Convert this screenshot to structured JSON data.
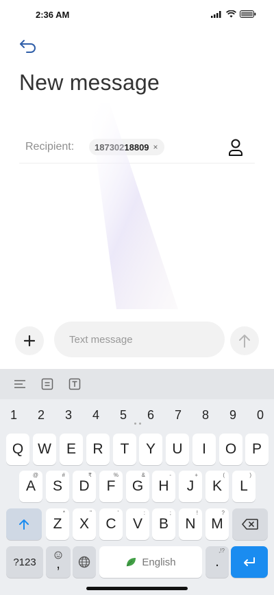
{
  "status": {
    "time": "2:36 AM"
  },
  "page": {
    "title": "New message"
  },
  "recipient": {
    "label": "Recipient:",
    "chip_number": "18730218809",
    "chip_remove": "×"
  },
  "compose": {
    "placeholder": "Text message"
  },
  "keyboard": {
    "numbers": [
      "1",
      "2",
      "3",
      "4",
      "5",
      "6",
      "7",
      "8",
      "9",
      "0"
    ],
    "row1": [
      {
        "key": "Q",
        "hint": ""
      },
      {
        "key": "W",
        "hint": ""
      },
      {
        "key": "E",
        "hint": ""
      },
      {
        "key": "R",
        "hint": ""
      },
      {
        "key": "T",
        "hint": ""
      },
      {
        "key": "Y",
        "hint": ""
      },
      {
        "key": "U",
        "hint": ""
      },
      {
        "key": "I",
        "hint": ""
      },
      {
        "key": "O",
        "hint": ""
      },
      {
        "key": "P",
        "hint": ""
      }
    ],
    "row2": [
      {
        "key": "A",
        "hint": "@"
      },
      {
        "key": "S",
        "hint": "#"
      },
      {
        "key": "D",
        "hint": "₹"
      },
      {
        "key": "F",
        "hint": "%"
      },
      {
        "key": "G",
        "hint": "&"
      },
      {
        "key": "H",
        "hint": "-"
      },
      {
        "key": "J",
        "hint": "+"
      },
      {
        "key": "K",
        "hint": "("
      },
      {
        "key": "L",
        "hint": ")"
      }
    ],
    "row3": [
      {
        "key": "Z",
        "hint": "*"
      },
      {
        "key": "X",
        "hint": "\""
      },
      {
        "key": "C",
        "hint": "'"
      },
      {
        "key": "V",
        "hint": ":"
      },
      {
        "key": "B",
        "hint": ";"
      },
      {
        "key": "N",
        "hint": "!"
      },
      {
        "key": "M",
        "hint": "?"
      }
    ],
    "symbols_key": "?123",
    "comma": ",",
    "space_label": "English",
    "period": ".",
    "period_hint": ",!?"
  },
  "colors": {
    "accent": "#1a8cf0",
    "icon_dark": "#2b2b2b",
    "back_arrow": "#2f5ea8",
    "leaf": "#43a047"
  },
  "icons": {
    "back": "back-arrow-icon",
    "contacts": "person-icon",
    "add": "plus-icon",
    "send": "arrow-up-icon",
    "toolbar": [
      "menu-lines-icon",
      "clipboard-icon",
      "text-box-icon"
    ],
    "shift": "shift-arrow-icon",
    "backspace": "backspace-icon",
    "emoji": "emoji-icon",
    "globe": "globe-icon",
    "leaf": "leaf-icon",
    "enter": "enter-icon"
  }
}
